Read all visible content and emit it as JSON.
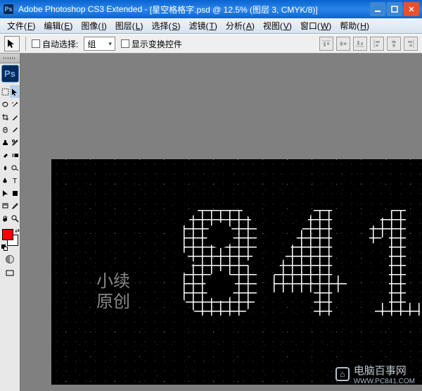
{
  "titlebar": {
    "app": "Adobe Photoshop CS3 Extended",
    "doc_title": "[星空格格字.psd @ 12.5% (图层 3, CMYK/8)]"
  },
  "menu": {
    "file": "文件",
    "file_u": "F",
    "edit": "编辑",
    "edit_u": "E",
    "image": "图像",
    "image_u": "I",
    "layer": "图层",
    "layer_u": "L",
    "select": "选择",
    "select_u": "S",
    "filter": "滤镜",
    "filter_u": "T",
    "analysis": "分析",
    "analysis_u": "A",
    "view": "视图",
    "view_u": "V",
    "window": "窗口",
    "window_u": "W",
    "help": "帮助",
    "help_u": "H"
  },
  "options": {
    "auto_select": "自动选择:",
    "group": "组",
    "show_transform": "显示变换控件"
  },
  "colors": {
    "fg": "#ff0000",
    "bg": "#ffffff"
  },
  "canvas": {
    "watermark_line1": "小续",
    "watermark_line2": "原创",
    "big_text": "841"
  },
  "footer_wm": {
    "name": "电脑百事网",
    "url": "WWW.PC841.COM"
  }
}
